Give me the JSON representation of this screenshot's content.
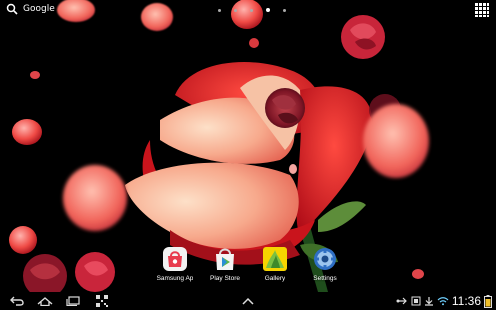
{
  "search": {
    "label": "Google"
  },
  "pager": {
    "pages": 5,
    "active_index": 3
  },
  "dock": {
    "apps": [
      {
        "label": "Samsung Ap",
        "icon": "samsung-apps-icon"
      },
      {
        "label": "Play Store",
        "icon": "play-store-icon"
      },
      {
        "label": "Gallery",
        "icon": "gallery-icon"
      },
      {
        "label": "Settings",
        "icon": "settings-icon"
      }
    ]
  },
  "status": {
    "time": "11:36"
  },
  "colors": {
    "petal": "#e83a3a",
    "rose_light": "#f7b79c",
    "background": "#000000"
  }
}
